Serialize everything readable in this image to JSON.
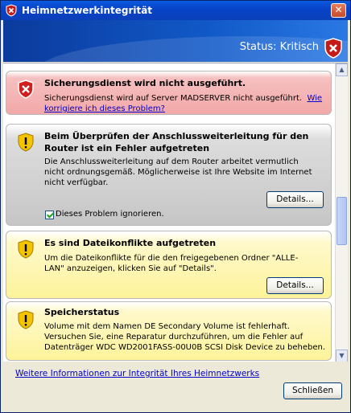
{
  "window": {
    "title": "Heimnetzwerkintegrität",
    "close_glyph": "✕"
  },
  "banner": {
    "status": "Status: Kritisch",
    "status_icon": "shield-error-icon"
  },
  "colors": {
    "title_bar": "#0a50d8",
    "critical_panel": "#f2a8a8",
    "neutral_panel": "#c6c6c6",
    "warning_panel": "#fdf39a",
    "link": "#0000cc"
  },
  "issues": [
    {
      "icon": "error-shield-icon",
      "title": "Sicherungsdienst wird nicht ausgeführt.",
      "text": "Sicherungsdienst wird auf Server MADSERVER nicht ausgeführt.",
      "link": "Wie korrigiere ich dieses Problem?"
    },
    {
      "icon": "warning-shield-icon",
      "title": "Beim Überprüfen der Anschlussweiterleitung für den Router ist ein Fehler aufgetreten",
      "text": "Die Anschlussweiterleitung auf dem Router arbeitet vermutlich nicht ordnungsgemäß. Möglicherweise ist Ihre Website im Internet nicht verfügbar.",
      "button": "Details...",
      "checkbox_label": "Dieses Problem ignorieren.",
      "checkbox_checked": true
    },
    {
      "icon": "warning-shield-icon",
      "title": "Es sind Dateikonflikte aufgetreten",
      "text": "Um die Dateikonflikte für die den freigegebenen Ordner \"ALLE-LAN\" anzuzeigen, klicken Sie auf \"Details\".",
      "button": "Details..."
    },
    {
      "icon": "warning-shield-icon",
      "title": "Speicherstatus",
      "text": "Volume mit dem Namen DE Secondary Volume ist fehlerhaft. Versuchen Sie, eine Reparatur durchzuführen, um die Fehler auf Datenträger WDC WD2001FASS-00U0B SCSI Disk Device zu beheben."
    }
  ],
  "footer": {
    "link": "Weitere Informationen zur Integrität Ihres Heimnetzwerks",
    "close_button": "Schließen"
  }
}
